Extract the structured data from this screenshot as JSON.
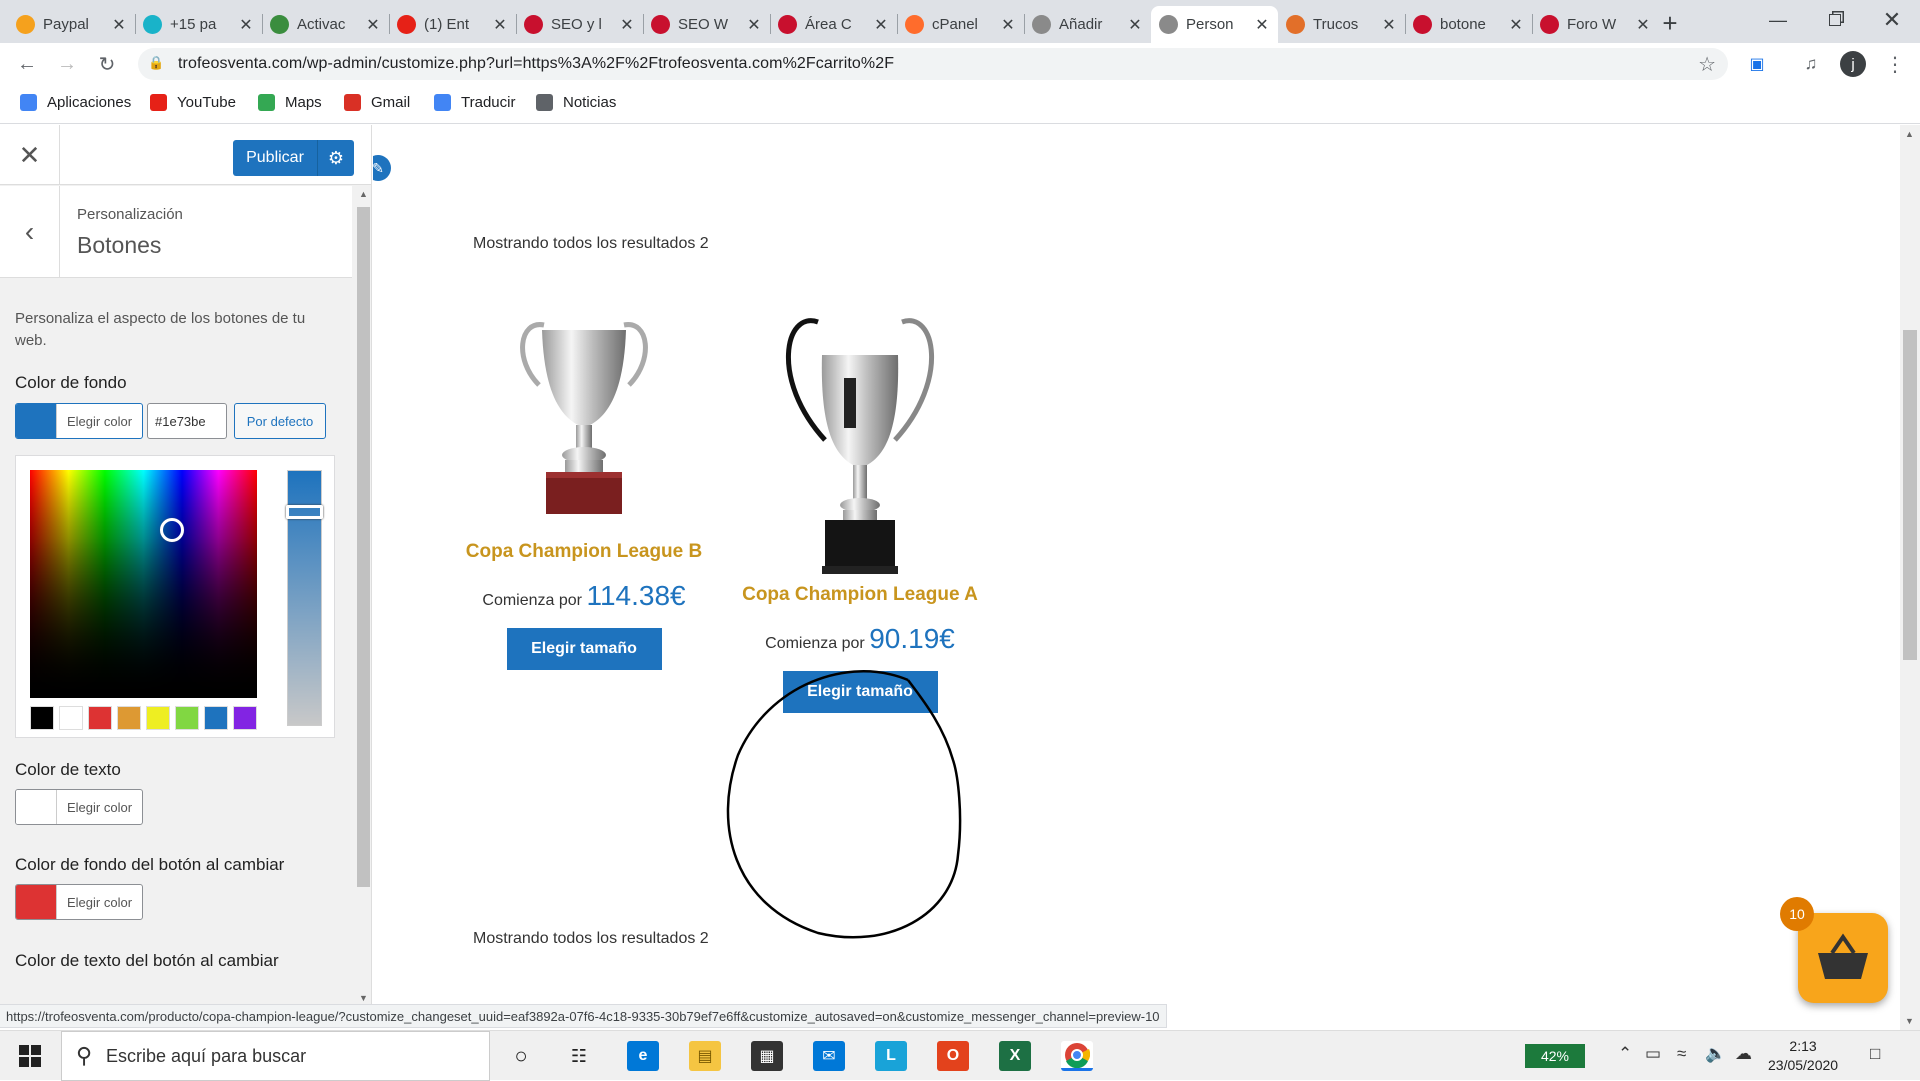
{
  "browser": {
    "tabs": [
      {
        "title": "Paypal",
        "fav_color": "#f5a11d"
      },
      {
        "title": "+15 pa",
        "fav_color": "#19b3c9"
      },
      {
        "title": "Activac",
        "fav_color": "#3a8d3e"
      },
      {
        "title": "(1) Ent",
        "fav_color": "#e62117"
      },
      {
        "title": "SEO y l",
        "fav_color": "#c8102e"
      },
      {
        "title": "SEO W",
        "fav_color": "#c8102e"
      },
      {
        "title": "Área C",
        "fav_color": "#c8102e"
      },
      {
        "title": "cPanel",
        "fav_color": "#ff6c2c"
      },
      {
        "title": "Añadir",
        "fav_color": "#8a8a8a"
      },
      {
        "title": "Person",
        "fav_color": "#8a8a8a"
      },
      {
        "title": "Trucos",
        "fav_color": "#e26f29"
      },
      {
        "title": "botone",
        "fav_color": "#c8102e"
      },
      {
        "title": "Foro W",
        "fav_color": "#c8102e"
      }
    ],
    "active_tab_index": 9,
    "url": "trofeosventa.com/wp-admin/customize.php?url=https%3A%2F%2Ftrofeosventa.com%2Fcarrito%2F",
    "bookmarks": [
      {
        "label": "Aplicaciones",
        "icon": "apps-grid-icon",
        "color": "#4285f4"
      },
      {
        "label": "YouTube",
        "icon": "youtube-icon",
        "color": "#e62117"
      },
      {
        "label": "Maps",
        "icon": "maps-icon",
        "color": "#34a853"
      },
      {
        "label": "Gmail",
        "icon": "gmail-icon",
        "color": "#d93025"
      },
      {
        "label": "Traducir",
        "icon": "translate-icon",
        "color": "#4285f4"
      },
      {
        "label": "Noticias",
        "icon": "news-icon",
        "color": "#5f6368"
      }
    ],
    "status_url": "https://trofeosventa.com/producto/copa-champion-league/?customize_changeset_uuid=eaf3892a-07f6-4c18-9335-30b79ef7e6ff&customize_autosaved=on&customize_messenger_channel=preview-10"
  },
  "customizer": {
    "publish_label": "Publicar",
    "breadcrumb": "Personalización",
    "section_title": "Botones",
    "description": "Personaliza el aspecto de los botones de tu web.",
    "bg_color_label": "Color de fondo",
    "pick_color_label": "Elegir color",
    "hex_value": "#1e73be",
    "default_label": "Por defecto",
    "text_color_label": "Color de texto",
    "hover_bg_label": "Color de fondo del botón al cambiar",
    "hover_text_label": "Color de texto del botón al cambiar",
    "colors": {
      "bg": "#1e73be",
      "text": "#ffffff",
      "hover_bg": "#dd3333"
    },
    "palette": [
      "#000000",
      "#ffffff",
      "#dd3333",
      "#dd9933",
      "#eeee22",
      "#81d742",
      "#1e73be",
      "#8224e3"
    ]
  },
  "preview": {
    "showing_top": "Mostrando todos los resultados 2",
    "showing_bottom": "Mostrando todos los resultados 2",
    "products": [
      {
        "name": "Copa Champion League B",
        "price_prefix": "Comienza por",
        "price": "114.38€",
        "button": "Elegir tamaño"
      },
      {
        "name": "Copa Champion League A",
        "price_prefix": "Comienza por",
        "price": "90.19€",
        "button": "Elegir tamaño"
      }
    ],
    "cart_count": "10"
  },
  "taskbar": {
    "search_placeholder": "Escribe aquí para buscar",
    "battery": "42%",
    "time": "2:13",
    "date": "23/05/2020"
  }
}
